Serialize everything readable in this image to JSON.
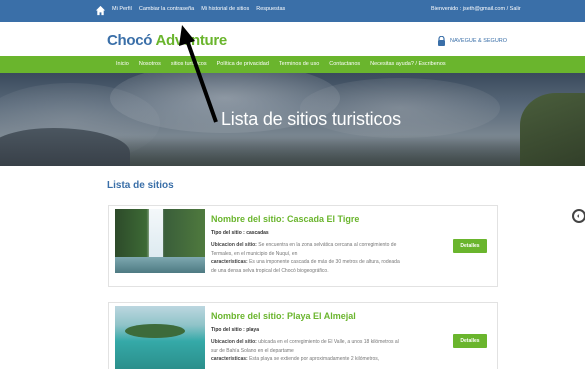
{
  "topbar": {
    "home_icon": "home-icon",
    "links": [
      "Mi Perfil",
      "Cambiar la contraseña",
      "Mi historial de sitios",
      "Respuestas"
    ],
    "welcome": "Bienvenido : jseth@gmail.com / Salir"
  },
  "brand": {
    "logo_main": "Chocó ",
    "logo_accent": "Adventure",
    "secure_label": "NAVEGUE & SEGURO",
    "lock_icon": "lock-icon"
  },
  "mainnav": {
    "items": [
      "Inicio",
      "Nosotros",
      "sitios turisticos",
      "Política de privacidad",
      "Terminos de uso",
      "Contactanos",
      "Necesitas ayuda? / Escribenos"
    ]
  },
  "hero": {
    "title": "Lista de sitios turisticos"
  },
  "section": {
    "title": "Lista de sitios"
  },
  "sites": [
    {
      "name": "Nombre del sitio: Cascada El Tigre",
      "type_label": "Tipo del sitio : ",
      "type": "cascadas",
      "location_label": "Ubicacion del sitio: ",
      "location": "Se encuentra en la zona selvática cercana al corregimiento de Termales, en el municipio de Nuquí, en",
      "features_label": "caracteristicas: ",
      "features": "Es una imponente cascada de más de 30 metros de altura, rodeada de una densa selva tropical del Chocó biogeográfico.",
      "button": "Detalles"
    },
    {
      "name": "Nombre del sitio: Playa El Almejal",
      "type_label": "Tipo del sitio : ",
      "type": "playa",
      "location_label": "Ubicacion del sitio: ",
      "location": "ubicada en el corregimiento de El Valle, a unos 18 kilómetros al sur de Bahía Solano en el departame",
      "features_label": "caracteristicas: ",
      "features": "Esta playa se extiende por aproximadamente 2 kilómetros,",
      "button": "Detalles"
    }
  ],
  "colors": {
    "topbar": "#3a6fa8",
    "green": "#6ab52d",
    "brand_blue": "#3a6fa8"
  }
}
